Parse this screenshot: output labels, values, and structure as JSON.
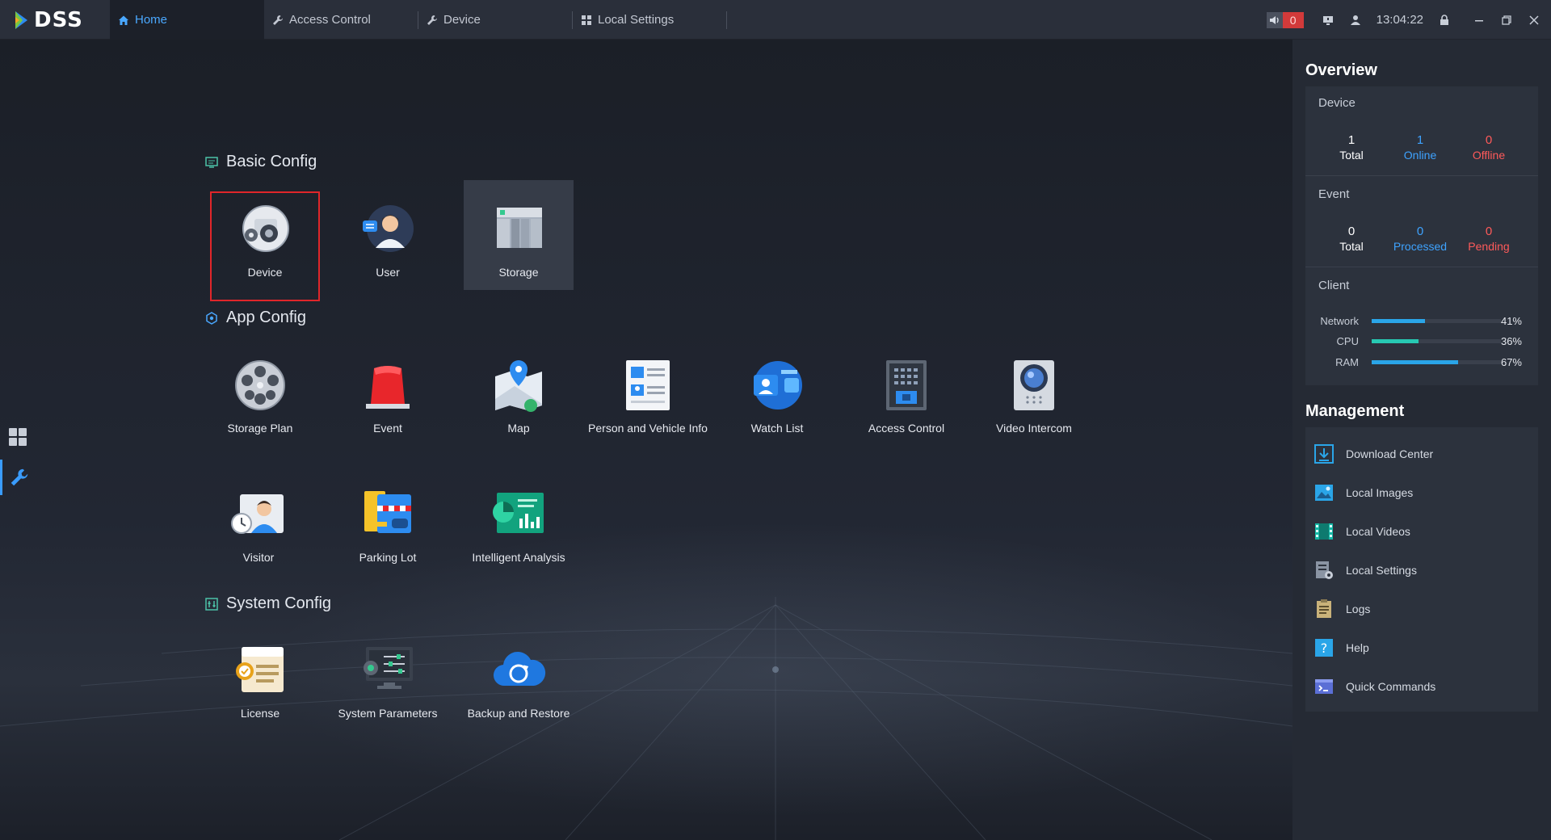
{
  "app": {
    "logo": "DSS"
  },
  "tabs": [
    {
      "label": "Home",
      "icon": "home-icon",
      "active": true
    },
    {
      "label": "Access Control",
      "icon": "wrench-icon",
      "active": false
    },
    {
      "label": "Device",
      "icon": "wrench-icon",
      "active": false
    },
    {
      "label": "Local Settings",
      "icon": "grid-icon",
      "active": false
    }
  ],
  "topbar": {
    "alarm_count": "0",
    "time": "13:04:22"
  },
  "sections": {
    "basic": "Basic Config",
    "app": "App Config",
    "system": "System Config"
  },
  "basic_items": [
    {
      "label": "Device",
      "icon": "device-config-icon"
    },
    {
      "label": "User",
      "icon": "user-icon"
    },
    {
      "label": "Storage",
      "icon": "storage-icon"
    }
  ],
  "app_items": [
    {
      "label": "Storage Plan",
      "icon": "film-reel-icon"
    },
    {
      "label": "Event",
      "icon": "siren-icon"
    },
    {
      "label": "Map",
      "icon": "map-icon"
    },
    {
      "label": "Person and Vehicle Info",
      "icon": "id-card-icon"
    },
    {
      "label": "Watch List",
      "icon": "watch-list-icon"
    },
    {
      "label": "Access Control",
      "icon": "access-panel-icon"
    },
    {
      "label": "Video Intercom",
      "icon": "intercom-icon"
    },
    {
      "label": "Visitor",
      "icon": "visitor-icon"
    },
    {
      "label": "Parking Lot",
      "icon": "parking-icon"
    },
    {
      "label": "Intelligent Analysis",
      "icon": "analysis-icon"
    }
  ],
  "system_items": [
    {
      "label": "License",
      "icon": "license-icon"
    },
    {
      "label": "System Parameters",
      "icon": "system-params-icon"
    },
    {
      "label": "Backup and Restore",
      "icon": "cloud-backup-icon"
    }
  ],
  "overview": {
    "title": "Overview",
    "device": {
      "title": "Device",
      "total": "1",
      "total_label": "Total",
      "online": "1",
      "online_label": "Online",
      "offline": "0",
      "offline_label": "Offline"
    },
    "event": {
      "title": "Event",
      "total": "0",
      "total_label": "Total",
      "processed": "0",
      "processed_label": "Processed",
      "pending": "0",
      "pending_label": "Pending"
    },
    "client": {
      "title": "Client",
      "network_label": "Network",
      "network": 0.41,
      "network_text": "41%",
      "cpu_label": "CPU",
      "cpu": 0.36,
      "cpu_text": "36%",
      "ram_label": "RAM",
      "ram": 0.67,
      "ram_text": "67%"
    }
  },
  "management": {
    "title": "Management",
    "items": [
      {
        "label": "Download Center",
        "icon": "download-icon"
      },
      {
        "label": "Local Images",
        "icon": "image-icon"
      },
      {
        "label": "Local Videos",
        "icon": "video-icon"
      },
      {
        "label": "Local Settings",
        "icon": "settings-doc-icon"
      },
      {
        "label": "Logs",
        "icon": "logs-icon"
      },
      {
        "label": "Help",
        "icon": "help-icon"
      },
      {
        "label": "Quick Commands",
        "icon": "commands-icon"
      }
    ]
  },
  "colors": {
    "accent": "#3ea3ff",
    "danger": "#ff5a5a",
    "network_bar": "#2aa5e8",
    "cpu_bar": "#27c9b3",
    "ram_bar": "#2aa5e8",
    "selection_outline": "#e0262a"
  }
}
